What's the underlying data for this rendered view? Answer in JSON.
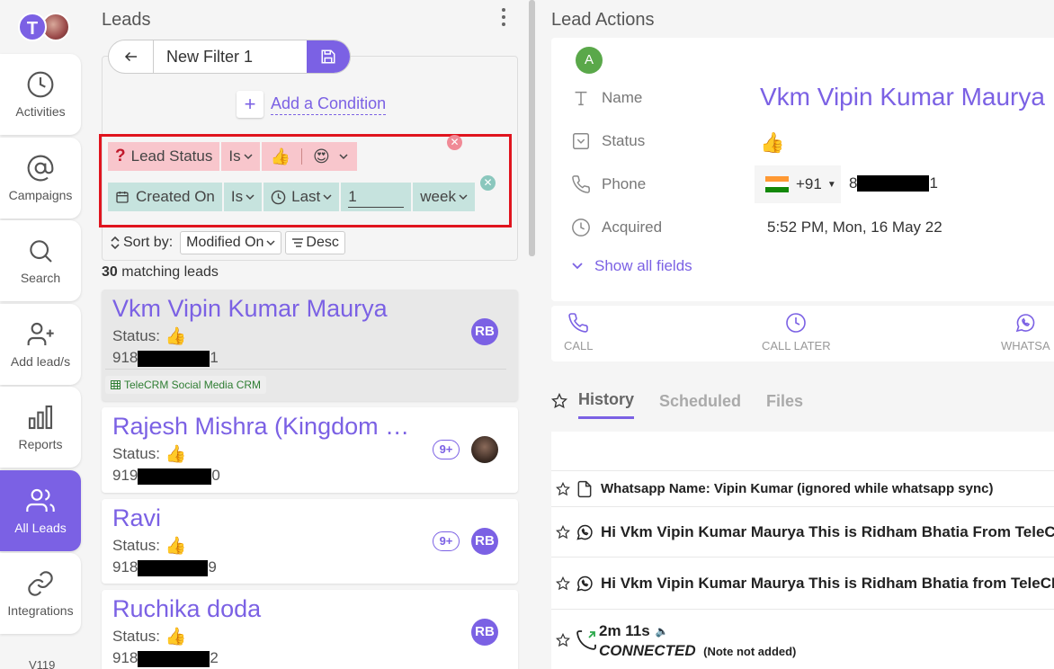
{
  "sidebar": {
    "user_initial": "T",
    "items": [
      {
        "label": "Activities",
        "icon": "clock-icon"
      },
      {
        "label": "Campaigns",
        "icon": "at-sign-icon"
      },
      {
        "label": "Search",
        "icon": "search-icon"
      },
      {
        "label": "Add lead/s",
        "icon": "add-user-icon"
      },
      {
        "label": "Reports",
        "icon": "bar-chart-icon"
      },
      {
        "label": "All Leads",
        "icon": "users-icon",
        "active": true
      },
      {
        "label": "Integrations",
        "icon": "link-icon"
      }
    ],
    "version": "V119"
  },
  "leads": {
    "title": "Leads",
    "filter": {
      "name": "New Filter 1",
      "add_condition_label": "Add a Condition",
      "conditions": [
        {
          "field": "Lead Status",
          "operator": "Is",
          "values": [
            "👍",
            "😍"
          ]
        },
        {
          "field": "Created On",
          "operator": "Is",
          "mode": "Last",
          "amount": "1",
          "unit": "week"
        }
      ]
    },
    "sort": {
      "label": "Sort by:",
      "field": "Modified On",
      "order": "Desc"
    },
    "match_count": "30",
    "match_label": "matching leads",
    "list": [
      {
        "name": "Vkm Vipin Kumar Maurya",
        "status_label": "Status:",
        "status": "👍",
        "phone_prefix": "918",
        "phone_suffix": "1",
        "badge": "RB",
        "tag": "TeleCRM Social Media CRM"
      },
      {
        "name": "Rajesh Mishra (Kingdom …",
        "status_label": "Status:",
        "status": "👍",
        "phone_prefix": "919",
        "phone_suffix": "0",
        "count": "9+"
      },
      {
        "name": "Ravi",
        "status_label": "Status:",
        "status": "👍",
        "phone_prefix": "918",
        "phone_suffix": "9",
        "count": "9+",
        "badge": "RB"
      },
      {
        "name": "Ruchika doda",
        "status_label": "Status:",
        "status": "👍",
        "phone_prefix": "918",
        "phone_suffix": "2",
        "badge": "RB"
      }
    ]
  },
  "actions": {
    "title": "Lead Actions",
    "avatar_initial": "A",
    "fields": {
      "name_label": "Name",
      "name_value": "Vkm Vipin Kumar Maurya",
      "status_label": "Status",
      "status_value": "👍",
      "phone_label": "Phone",
      "phone_code": "+91",
      "phone_prefix": "8",
      "phone_suffix": "1",
      "acquired_label": "Acquired",
      "acquired_value": "5:52 PM, Mon, 16 May 22"
    },
    "show_all_label": "Show all fields",
    "buttons": {
      "call": "CALL",
      "call_later": "CALL LATER",
      "whatsapp": "WHATSA"
    },
    "tabs": [
      "History",
      "Scheduled",
      "Files"
    ],
    "history": [
      {
        "text": "Whatsapp Name: Vipin Kumar (ignored while whatsapp sync)",
        "icon": "document-icon"
      },
      {
        "text": "Hi Vkm Vipin Kumar Maurya This is Ridham Bhatia From TeleCRM",
        "icon": "whatsapp-icon"
      },
      {
        "text": "Hi Vkm Vipin Kumar Maurya This is Ridham Bhatia from TeleCRM",
        "icon": "whatsapp-icon"
      }
    ],
    "call_log": {
      "duration": "2m 11s",
      "status": "CONNECTED",
      "note": "(Note not added)"
    }
  },
  "colors": {
    "accent": "#7b61e4",
    "pink_chip": "#f8c6cc",
    "teal_chip": "#c6e3de",
    "highlight": "#e0141e"
  }
}
